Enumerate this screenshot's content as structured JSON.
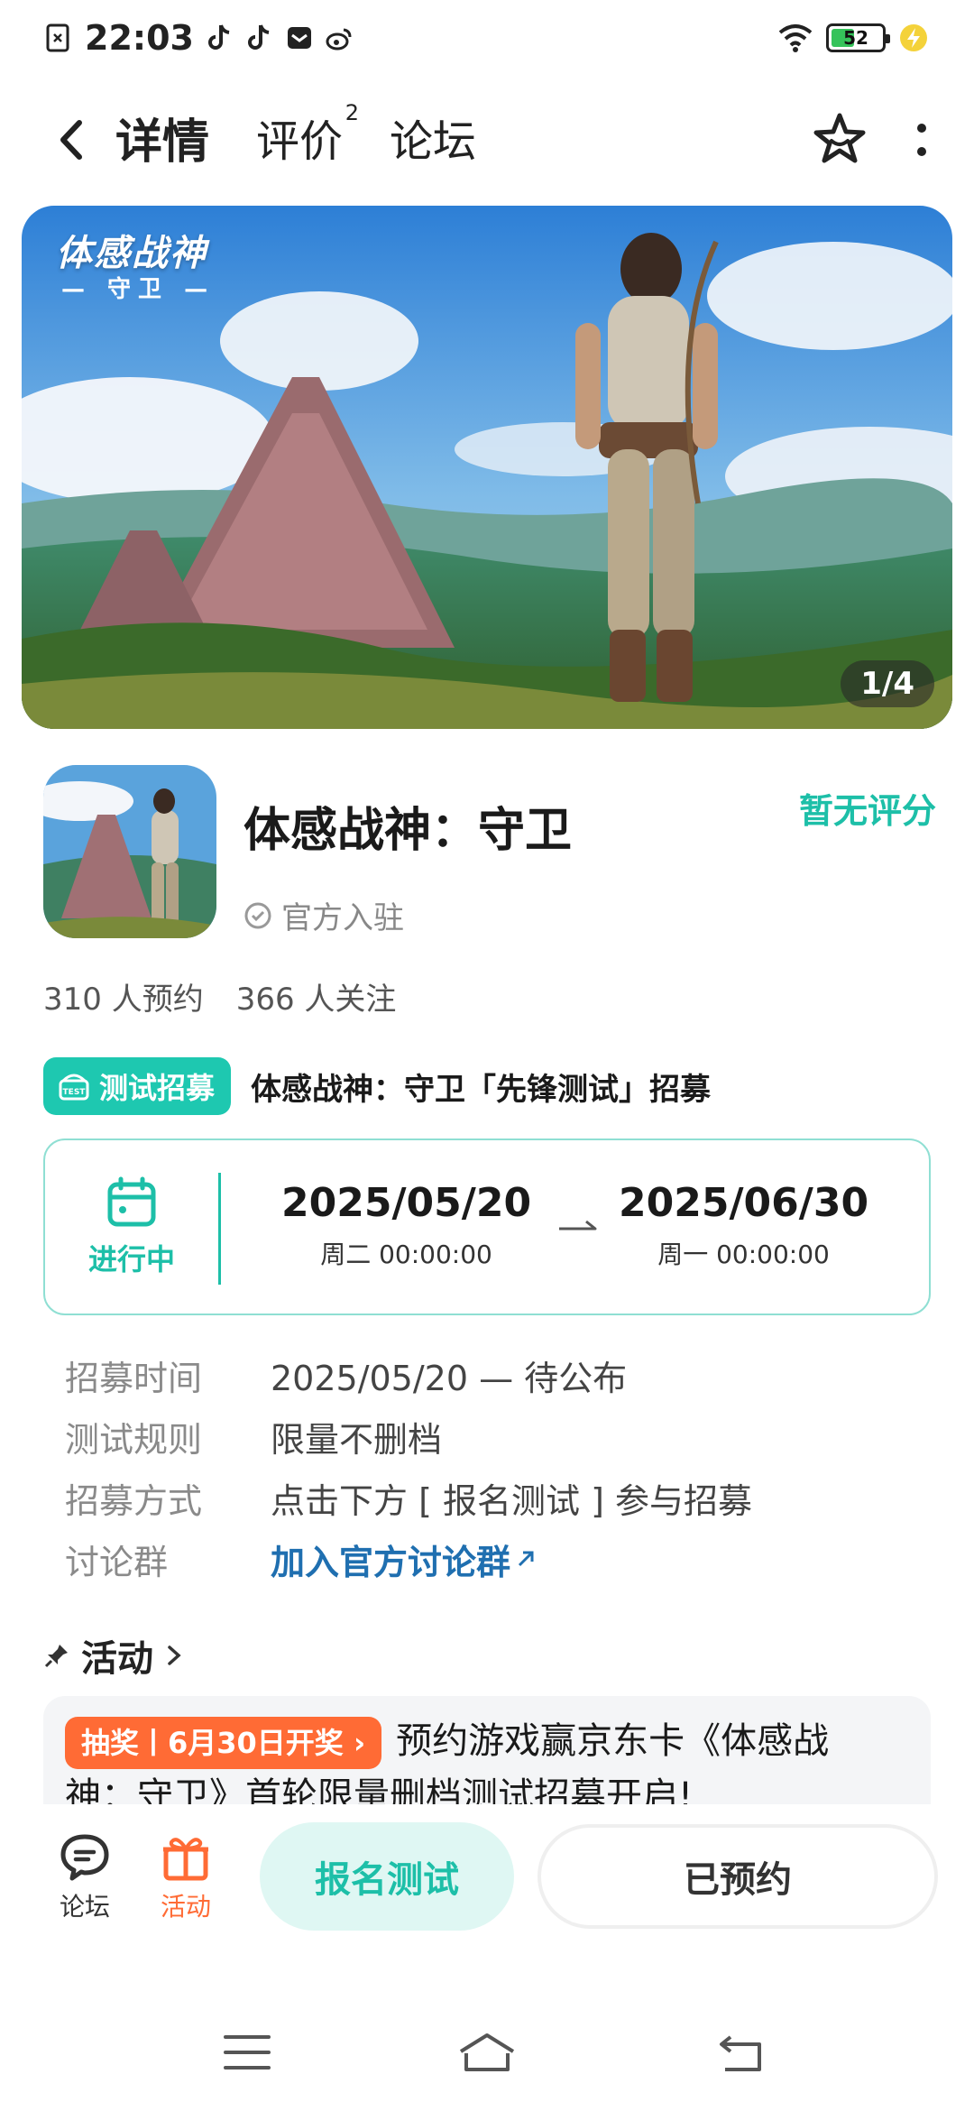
{
  "status_bar": {
    "time": "22:03",
    "battery_level": "52",
    "battery_fraction": 0.52
  },
  "nav": {
    "tabs": [
      {
        "label": "详情",
        "active": true
      },
      {
        "label": "评价",
        "badge": "2",
        "active": false
      },
      {
        "label": "论坛",
        "active": false
      }
    ]
  },
  "banner": {
    "logo_text": "体感战神",
    "logo_sub": "— 守卫 —",
    "counter": "1/4"
  },
  "app": {
    "title": "体感战神：守卫",
    "official": "官方入驻",
    "rating": "暂无评分"
  },
  "stats": {
    "reservations": "310 人预约",
    "followers": "366 人关注"
  },
  "recruit": {
    "tag": "测试招募",
    "title": "体感战神：守卫「先锋测试」招募",
    "status": "进行中",
    "start_date": "2025/05/20",
    "start_time": "周二  00:00:00",
    "end_date": "2025/06/30",
    "end_time": "周一  00:00:00"
  },
  "info": [
    {
      "label": "招募时间",
      "value": "2025/05/20 — 待公布"
    },
    {
      "label": "测试规则",
      "value": "限量不删档"
    },
    {
      "label": "招募方式",
      "value": "点击下方 [ 报名测试 ] 参与招募"
    },
    {
      "label": "讨论群",
      "value": "加入官方讨论群"
    }
  ],
  "activity": {
    "heading": "活动",
    "badge": "抽奖丨6月30日开奖",
    "line1": "预约游戏赢京东卡《体感战",
    "line2": "神：守卫》首轮限量删档测试招募开启!"
  },
  "bottom": {
    "forum_label": "论坛",
    "activity_label": "活动",
    "signup_label": "报名测试",
    "reserved_label": "已预约"
  },
  "colors": {
    "accent": "#1dbfa8",
    "orange": "#ff6b35",
    "link": "#1f6fb0"
  }
}
